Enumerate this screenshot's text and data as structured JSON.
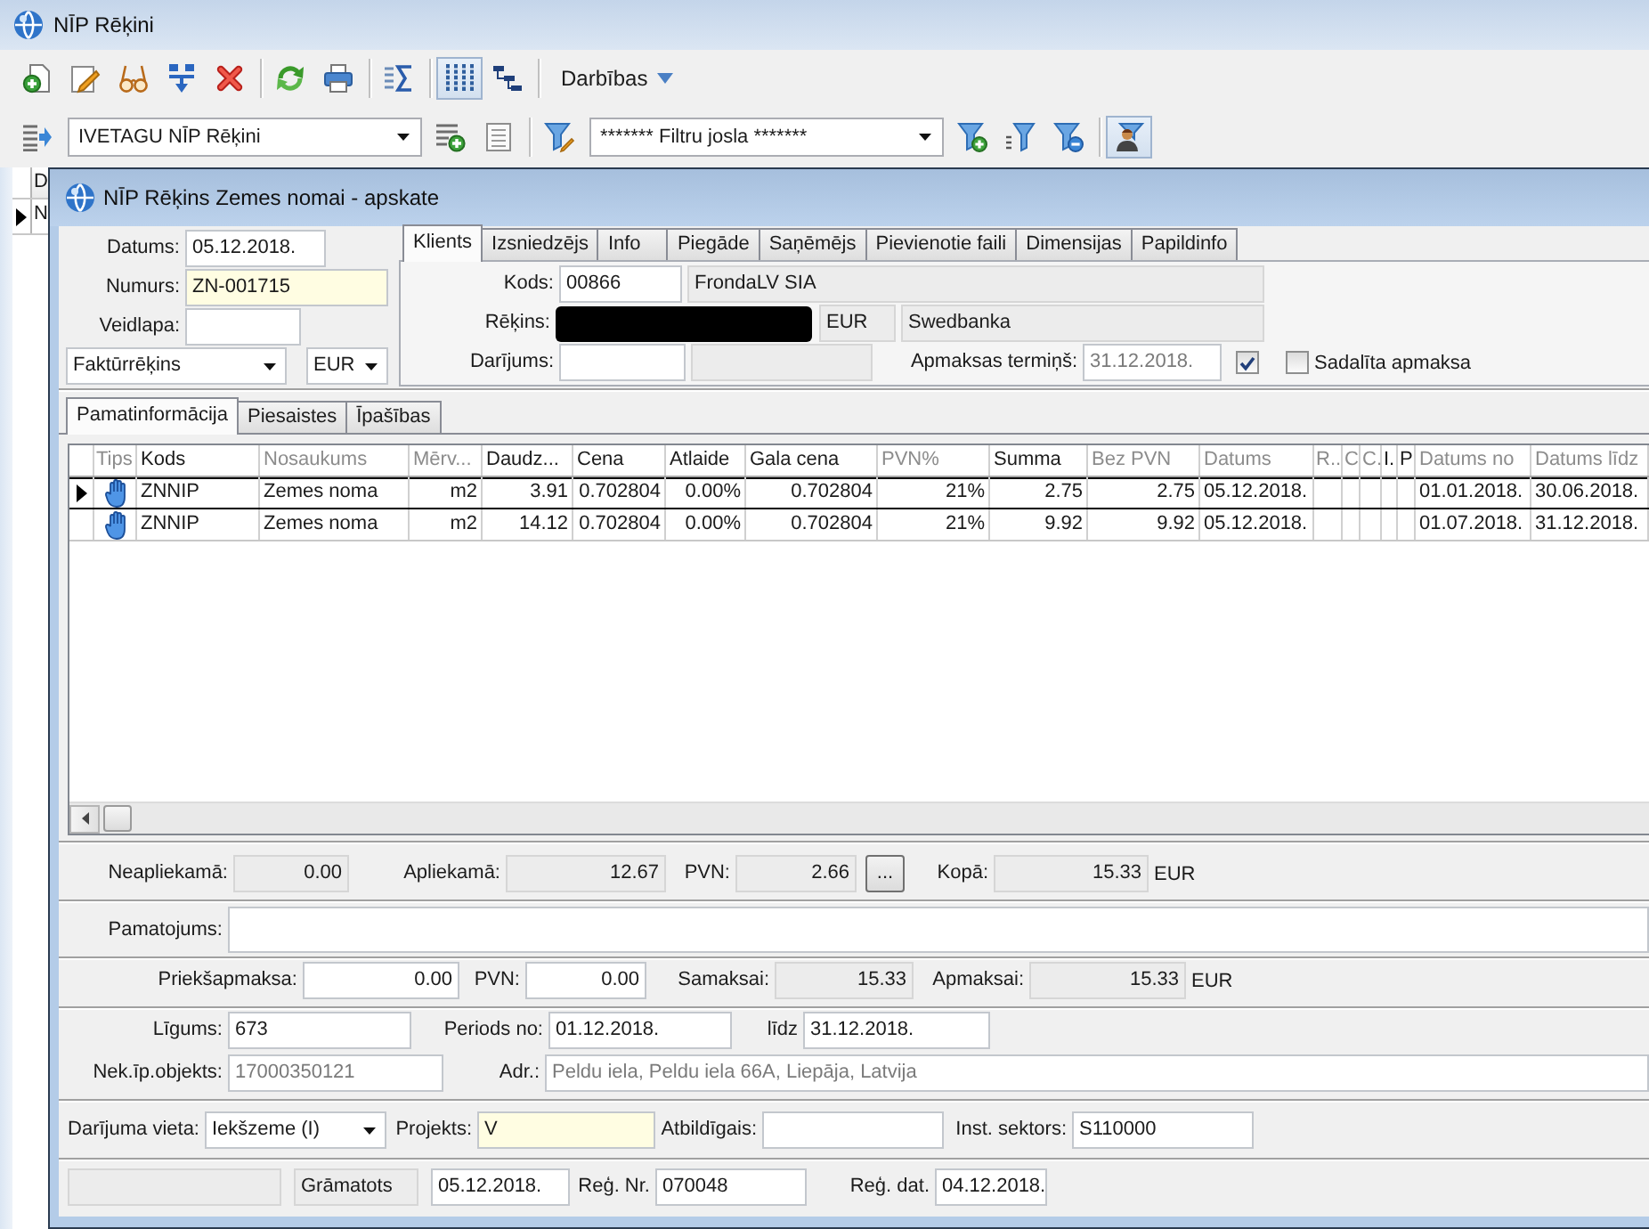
{
  "window": {
    "title": "NĪP Rēķini"
  },
  "toolbar": {
    "column_view_pressed": true,
    "menu_label": "Darbības"
  },
  "filter_bar": {
    "layout_select": {
      "value": "IVETAGU NĪP Rēķini"
    },
    "filter_select": {
      "value": "******* Filtru josla *******"
    },
    "user_filter_pressed": true
  },
  "background_list": {
    "column_1": "D",
    "rows": [
      {
        "column_1": "N",
        "selected": true
      }
    ]
  },
  "dialog": {
    "title": "NĪP Rēķins Zemes nomai - apskate",
    "header": {
      "rows": [
        [
          {
            "kind": "input",
            "label": "Datums:",
            "value": "05.12.2018."
          }
        ],
        [
          {
            "kind": "highlighted",
            "label": "Numurs:",
            "value": "ZN-001715"
          }
        ],
        [
          {
            "kind": "input",
            "label": "Veidlapa:"
          }
        ],
        [
          {
            "kind": "select",
            "value": "Faktūrrēķins"
          },
          {
            "kind": "select",
            "value": "EUR"
          }
        ]
      ]
    },
    "party_tabs": [
      {
        "label": "Klients",
        "selected": true
      },
      {
        "label": "Izsniedzējs",
        "selected": false
      },
      {
        "label": "Info",
        "selected": false
      },
      {
        "label": "Piegāde",
        "selected": false
      },
      {
        "label": "Saņēmējs",
        "selected": false
      },
      {
        "label": "Pievienotie faili",
        "selected": false
      },
      {
        "label": "Dimensijas",
        "selected": false
      },
      {
        "label": "Papildinfo",
        "selected": false
      }
    ],
    "client": {
      "rows": [
        [
          {
            "kind": "input",
            "label": "Kods:",
            "value": "00866"
          },
          {
            "kind": "readonly",
            "value": "FrondaLV SIA"
          }
        ],
        [
          {
            "kind": "redacted",
            "label": "Rēķins:"
          },
          {
            "kind": "readonly",
            "value": "EUR"
          },
          {
            "kind": "readonly",
            "value": "Swedbanka"
          }
        ],
        [
          {
            "kind": "input",
            "label": "Darījums:"
          },
          {
            "kind": "readonly"
          },
          {
            "kind": "disabled",
            "label": "Apmaksas termiņš:",
            "value": "31.12.2018."
          },
          {
            "kind": "checkbox",
            "checked": true
          },
          {
            "kind": "checkbox",
            "label": "Sadalīta apmaksa",
            "checked": false
          }
        ]
      ]
    },
    "detail_tabs": [
      {
        "label": "Pamatinformācija",
        "selected": true
      },
      {
        "label": "Piesaistes",
        "selected": false
      },
      {
        "label": "Īpašības",
        "selected": false
      }
    ],
    "lines_table": {
      "columns": [
        {
          "label": "Tips",
          "dimmed": true
        },
        {
          "label": "Kods",
          "dimmed": false
        },
        {
          "label": "Nosaukums",
          "dimmed": true
        },
        {
          "label": "Mērv...",
          "dimmed": true
        },
        {
          "label": "Daudz...",
          "dimmed": false
        },
        {
          "label": "Cena",
          "dimmed": false
        },
        {
          "label": "Atlaide",
          "dimmed": false
        },
        {
          "label": "Gala cena",
          "dimmed": false
        },
        {
          "label": "PVN%",
          "dimmed": true
        },
        {
          "label": "Summa",
          "dimmed": false
        },
        {
          "label": "Bez PVN",
          "dimmed": true
        },
        {
          "label": "Datums",
          "dimmed": true
        },
        {
          "label": "R..",
          "dimmed": true
        },
        {
          "label": "C",
          "dimmed": true
        },
        {
          "label": "C.",
          "dimmed": true
        },
        {
          "label": "I.",
          "dimmed": false
        },
        {
          "label": "P",
          "dimmed": false
        },
        {
          "label": "Datums no",
          "dimmed": true
        },
        {
          "label": "Datums līdz",
          "dimmed": true
        }
      ],
      "rows": [
        {
          "selected": true,
          "cells": [
            "",
            "ZNNIP",
            "Zemes noma",
            "m2",
            "3.91",
            "0.702804",
            "0.00%",
            "0.702804",
            "21%",
            "2.75",
            "2.75",
            "05.12.2018.",
            "",
            "",
            "",
            "",
            "",
            "01.01.2018.",
            "30.06.2018."
          ]
        },
        {
          "selected": false,
          "cells": [
            "",
            "ZNNIP",
            "Zemes noma",
            "m2",
            "14.12",
            "0.702804",
            "0.00%",
            "0.702804",
            "21%",
            "9.92",
            "9.92",
            "05.12.2018.",
            "",
            "",
            "",
            "",
            "",
            "01.07.2018.",
            "31.12.2018."
          ]
        }
      ]
    },
    "sections": [
      {
        "rows": [
          [
            {
              "kind": "readonly",
              "label": "Neapliekamā:",
              "value": "0.00"
            },
            {
              "kind": "readonly",
              "label": "Apliekamā:",
              "value": "12.67"
            },
            {
              "kind": "readonly",
              "label": "PVN:",
              "value": "2.66"
            },
            {
              "kind": "button",
              "label": "..."
            },
            {
              "kind": "readonly",
              "label": "Kopā:",
              "value": "15.33"
            },
            {
              "kind": "unit",
              "value": "EUR"
            }
          ]
        ]
      },
      {
        "rows": [
          [
            {
              "kind": "input",
              "label": "Pamatojums:"
            }
          ]
        ]
      },
      {
        "rows": [
          [
            {
              "kind": "input",
              "label": "Priekšapmaksa:",
              "value": "0.00"
            },
            {
              "kind": "input",
              "label": "PVN:",
              "value": "0.00"
            },
            {
              "kind": "readonly",
              "label": "Samaksai:",
              "value": "15.33"
            },
            {
              "kind": "readonly",
              "label": "Apmaksai:",
              "value": "15.33"
            },
            {
              "kind": "unit",
              "value": "EUR"
            }
          ]
        ]
      },
      {
        "rows": [
          [
            {
              "kind": "input",
              "label": "Līgums:",
              "value": "673"
            },
            {
              "kind": "input",
              "label": "Periods no:",
              "value": "01.12.2018."
            },
            {
              "kind": "input",
              "label": "līdz",
              "value": "31.12.2018."
            }
          ],
          [
            {
              "kind": "disabled",
              "label": "Nek.īp.objekts:",
              "value": "17000350121"
            },
            {
              "kind": "disabled",
              "label": "Adr.:",
              "value": "Peldu iela, Peldu iela 66A, Liepāja, Latvija"
            }
          ]
        ]
      },
      {
        "rows": [
          [
            {
              "kind": "select",
              "label": "Darījuma vieta:",
              "value": "Iekšzeme (I)"
            },
            {
              "kind": "highlighted",
              "label": "Projekts:",
              "value": "V"
            },
            {
              "kind": "input",
              "label": "Atbildīgais:"
            },
            {
              "kind": "input",
              "label": "Inst. sektors:",
              "value": "S110000"
            }
          ]
        ]
      },
      {
        "rows": [
          [
            {
              "kind": "readonly"
            },
            {
              "kind": "readonly",
              "value": "Grāmatots"
            },
            {
              "kind": "input",
              "value": "05.12.2018."
            },
            {
              "kind": "input",
              "label": "Reģ. Nr.",
              "value": "070048"
            },
            {
              "kind": "input",
              "label": "Reģ. dat.",
              "value": "04.12.2018."
            }
          ]
        ]
      }
    ]
  }
}
